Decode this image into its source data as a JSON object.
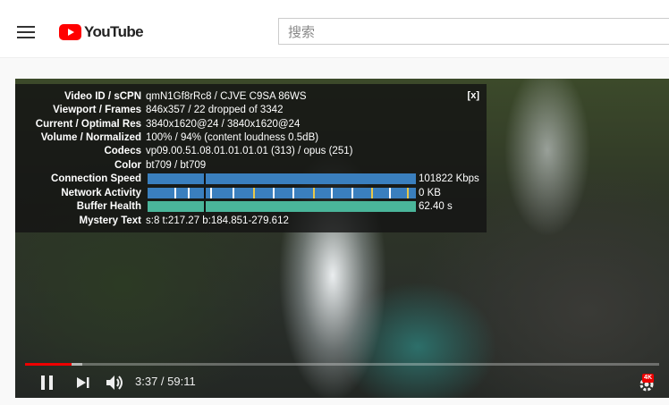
{
  "header": {
    "logo_text": "YouTube",
    "search_placeholder": "搜索"
  },
  "stats": {
    "close_label": "[x]",
    "rows": [
      {
        "label": "Video ID / sCPN",
        "value": "qmN1Gf8rRc8 / CJVE C9SA 86WS"
      },
      {
        "label": "Viewport / Frames",
        "value": "846x357 / 22 dropped of 3342"
      },
      {
        "label": "Current / Optimal Res",
        "value": "3840x1620@24 / 3840x1620@24"
      },
      {
        "label": "Volume / Normalized",
        "value": "100% / 94% (content loudness 0.5dB)"
      },
      {
        "label": "Codecs",
        "value": "vp09.00.51.08.01.01.01.01 (313) / opus (251)"
      },
      {
        "label": "Color",
        "value": "bt709 / bt709"
      },
      {
        "label": "Connection Speed",
        "value": "101822 Kbps"
      },
      {
        "label": "Network Activity",
        "value": "0 KB"
      },
      {
        "label": "Buffer Health",
        "value": "62.40 s"
      },
      {
        "label": "Mystery Text",
        "value": "s:8 t:217.27 b:184.851-279.612"
      }
    ]
  },
  "player": {
    "progress_played": 0.073,
    "progress_loaded": 0.09,
    "time": "3:37 / 59:11",
    "quality_badge": "4K"
  },
  "colors": {
    "brand_red": "#ff0000",
    "speed_bar": "#3a7fbe",
    "buffer_bar": "#4ab59a",
    "progress_played": "#ee0000"
  },
  "icons": [
    "menu-icon",
    "youtube-play-icon",
    "close-icon",
    "pause-icon",
    "next-icon",
    "volume-icon",
    "settings-icon"
  ]
}
